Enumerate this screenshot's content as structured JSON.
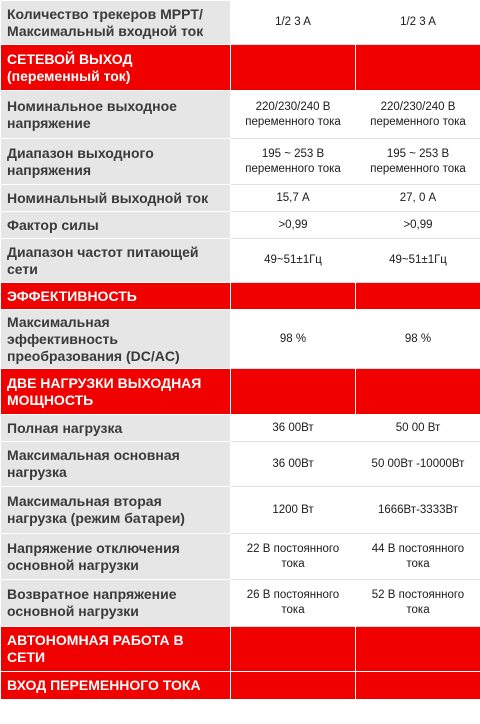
{
  "rows": [
    {
      "type": "data",
      "label": "Количество трекеров MPPT/ Максимальный входной ток",
      "v1": "1/2 3 A",
      "v2": "1/2 3 A"
    },
    {
      "type": "section",
      "label": "СЕТЕВОЙ ВЫХОД (переменный ток)"
    },
    {
      "type": "data",
      "label": "Номинальное выходное напряжение",
      "v1": "220/230/240 В переменного тока",
      "v2": "220/230/240 В переменного тока"
    },
    {
      "type": "data",
      "label": "Диапазон выходного напряжения",
      "v1": "195 ~ 253 В переменного тока",
      "v2": "195 ~ 253 В переменного тока"
    },
    {
      "type": "data",
      "label": "Номинальный выходной ток",
      "v1": "15,7 А",
      "v2": "27, 0 А"
    },
    {
      "type": "data",
      "label": "Фактор силы",
      "v1": ">0,99",
      "v2": ">0,99"
    },
    {
      "type": "data",
      "label": "Диапазон частот питающей сети",
      "v1": "49~51±1Гц",
      "v2": "49~51±1Гц"
    },
    {
      "type": "section",
      "label": "ЭФФЕКТИВНОСТЬ"
    },
    {
      "type": "data",
      "label": "Максимальная эффективность преобразования (DC/AC)",
      "v1": "98 %",
      "v2": "98 %"
    },
    {
      "type": "section",
      "label": "ДВЕ НАГРУЗКИ ВЫХОДНАЯ МОЩНОСТЬ"
    },
    {
      "type": "data",
      "label": "Полная нагрузка",
      "v1": "36 00Вт",
      "v2": "50 00 Вт"
    },
    {
      "type": "data",
      "label": "Максимальная основная нагрузка",
      "v1": "36 00Вт",
      "v2": "50 00Вт -10000Вт"
    },
    {
      "type": "data",
      "label": "Максимальная вторая нагрузка (режим батареи)",
      "v1": "1200 Вт",
      "v2": "1666Вт-3333Вт"
    },
    {
      "type": "data",
      "label": "Напряжение отключения основной нагрузки",
      "v1": "22 В постоянного тока",
      "v2": "44 В постоянного тока"
    },
    {
      "type": "data",
      "label": "Возвратное напряжение основной нагрузки",
      "v1": "26 В постоянного тока",
      "v2": "52 В постоянного тока"
    },
    {
      "type": "section",
      "label": "АВТОНОМНАЯ РАБОТА В СЕТИ"
    },
    {
      "type": "section",
      "label": "ВХОД ПЕРЕМЕННОГО ТОКА"
    }
  ],
  "colors": {
    "section_bg": "#f10000",
    "label_bg": "#e6e6e6",
    "value_bg": "#ffffff",
    "section_text": "#ffffff"
  }
}
